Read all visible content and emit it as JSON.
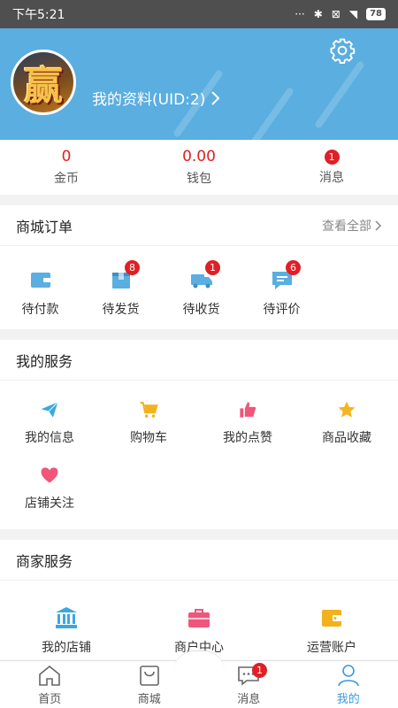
{
  "status": {
    "time": "下午5:21",
    "battery": "78"
  },
  "profile": {
    "link_label": "我的资料(UID:2)",
    "avatar_char": "赢"
  },
  "stats": [
    {
      "value": "0",
      "label": "金币"
    },
    {
      "value": "0.00",
      "label": "钱包"
    },
    {
      "badge": "1",
      "label": "消息"
    }
  ],
  "orders": {
    "title": "商城订单",
    "more": "查看全部",
    "items": [
      {
        "label": "待付款",
        "icon": "wallet-icon",
        "badge": ""
      },
      {
        "label": "待发货",
        "icon": "package-icon",
        "badge": "8"
      },
      {
        "label": "待收货",
        "icon": "truck-icon",
        "badge": "1"
      },
      {
        "label": "待评价",
        "icon": "comment-icon",
        "badge": "6"
      }
    ]
  },
  "services": {
    "title": "我的服务",
    "items": [
      {
        "label": "我的信息",
        "icon": "paper-plane-icon"
      },
      {
        "label": "购物车",
        "icon": "cart-icon"
      },
      {
        "label": "我的点赞",
        "icon": "thumbs-up-icon"
      },
      {
        "label": "商品收藏",
        "icon": "star-icon"
      },
      {
        "label": "店铺关注",
        "icon": "heart-icon"
      }
    ]
  },
  "merchant": {
    "title": "商家服务",
    "items": [
      {
        "label": "我的店铺",
        "icon": "bank-icon"
      },
      {
        "label": "商户中心",
        "icon": "briefcase-icon"
      },
      {
        "label": "运营账户",
        "icon": "wallet-icon"
      }
    ]
  },
  "tabs": [
    {
      "label": "首页",
      "icon": "home-icon"
    },
    {
      "label": "商城",
      "icon": "shopping-bag-icon"
    },
    {
      "label": "消息",
      "icon": "chat-icon",
      "badge": "1"
    },
    {
      "label": "我的",
      "icon": "user-icon",
      "active": true
    }
  ],
  "colors": {
    "header": "#5aaee0",
    "accent": "#3a9bd9",
    "badge": "#e01f26"
  }
}
